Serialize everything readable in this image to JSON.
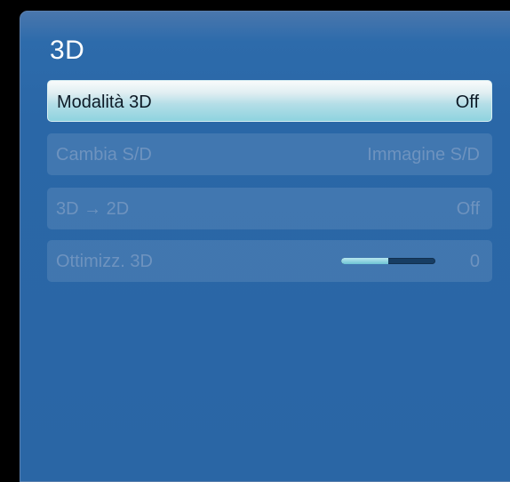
{
  "panel": {
    "title": "3D"
  },
  "menu": {
    "items": [
      {
        "label": "Modalità 3D",
        "value": "Off",
        "selected": true,
        "enabled": true
      },
      {
        "label": "Cambia S/D",
        "value": "Immagine S/D",
        "selected": false,
        "enabled": false
      },
      {
        "label": "3D → 2D",
        "value": "Off",
        "selected": false,
        "enabled": false
      },
      {
        "label": "Ottimizz. 3D",
        "value": "0",
        "selected": false,
        "enabled": false,
        "slider_level": 0.5
      }
    ]
  },
  "colors": {
    "background": "#000000",
    "panel": "#2a66a5",
    "highlight": "#b4dee7",
    "disabled_text": "#6e93bf",
    "slider_fill": "#6dc3d3",
    "slider_track": "#173d63"
  }
}
